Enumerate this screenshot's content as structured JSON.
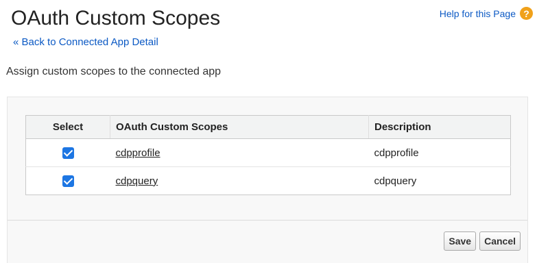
{
  "header": {
    "title": "OAuth Custom Scopes",
    "back_link": "« Back to Connected App Detail",
    "help_link": "Help for this Page",
    "help_icon": "?"
  },
  "subtitle": "Assign custom scopes to the connected app",
  "table": {
    "columns": [
      "Select",
      "OAuth Custom Scopes",
      "Description"
    ],
    "rows": [
      {
        "selected": true,
        "scope": "cdpprofile",
        "description": "cdpprofile"
      },
      {
        "selected": true,
        "scope": "cdpquery",
        "description": "cdpquery"
      }
    ]
  },
  "buttons": {
    "save": "Save",
    "cancel": "Cancel"
  },
  "colors": {
    "link": "#0b59c4",
    "checkbox": "#1d76e3",
    "help_icon": "#f0a11a"
  }
}
